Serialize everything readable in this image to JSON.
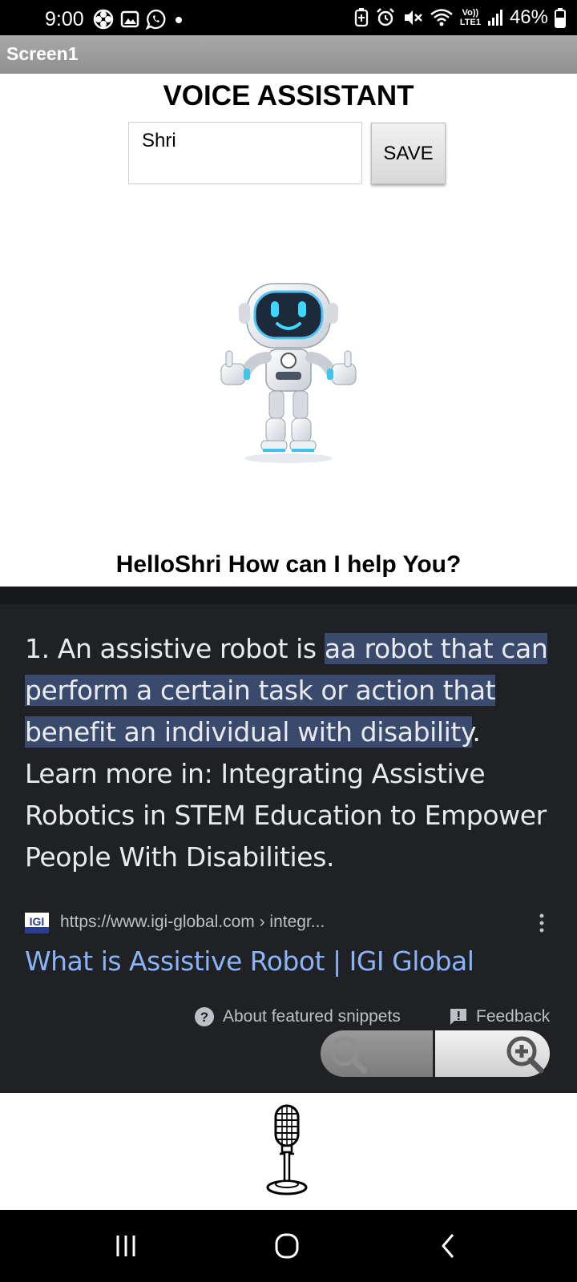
{
  "status_bar": {
    "time": "9:00",
    "left_icons": [
      "pinwheel-icon",
      "gallery-icon",
      "whatsapp-icon",
      "dot-icon"
    ],
    "right_icons": [
      "battery-saver-icon",
      "alarm-icon",
      "mute-icon",
      "wifi-icon",
      "volte-lte-icon",
      "signal-icon",
      "battery-icon"
    ],
    "network_label_top": "Vo))",
    "network_label_bottom": "LTE1",
    "battery_percent": "46%"
  },
  "title_bar": {
    "title": "Screen1"
  },
  "app": {
    "title": "VOICE ASSISTANT",
    "name_input": {
      "value": "Shri"
    },
    "save_label": "SAVE",
    "robot_image": "robot-thumbs-up",
    "greeting": "HelloShri  How can I help You?"
  },
  "snippet": {
    "prefix": "1. An assistive robot is ",
    "highlight": "aa robot that can perform a certain task or action that benefit an individual with disability",
    "suffix": ". Learn more in: Integrating Assistive Robotics in STEM Education to Empower People With Disabilities.",
    "source_logo": "IGI",
    "source_url": "https://www.igi-global.com › integr...",
    "link_title": "What is Assistive Robot | IGI Global",
    "about_label": "About featured snippets",
    "feedback_label": "Feedback"
  },
  "zoom": {
    "out_icon": "zoom-out-icon",
    "in_icon": "zoom-in-icon"
  },
  "mic": {
    "icon": "microphone-icon"
  },
  "nav": {
    "icons": [
      "recent-apps-icon",
      "home-icon",
      "back-icon"
    ]
  },
  "colors": {
    "dark_panel": "#202124",
    "highlight_bg": "#394a6d",
    "link": "#8ab4f8",
    "snippet_text": "#e8eaed",
    "muted_text": "#bdc1c6"
  }
}
